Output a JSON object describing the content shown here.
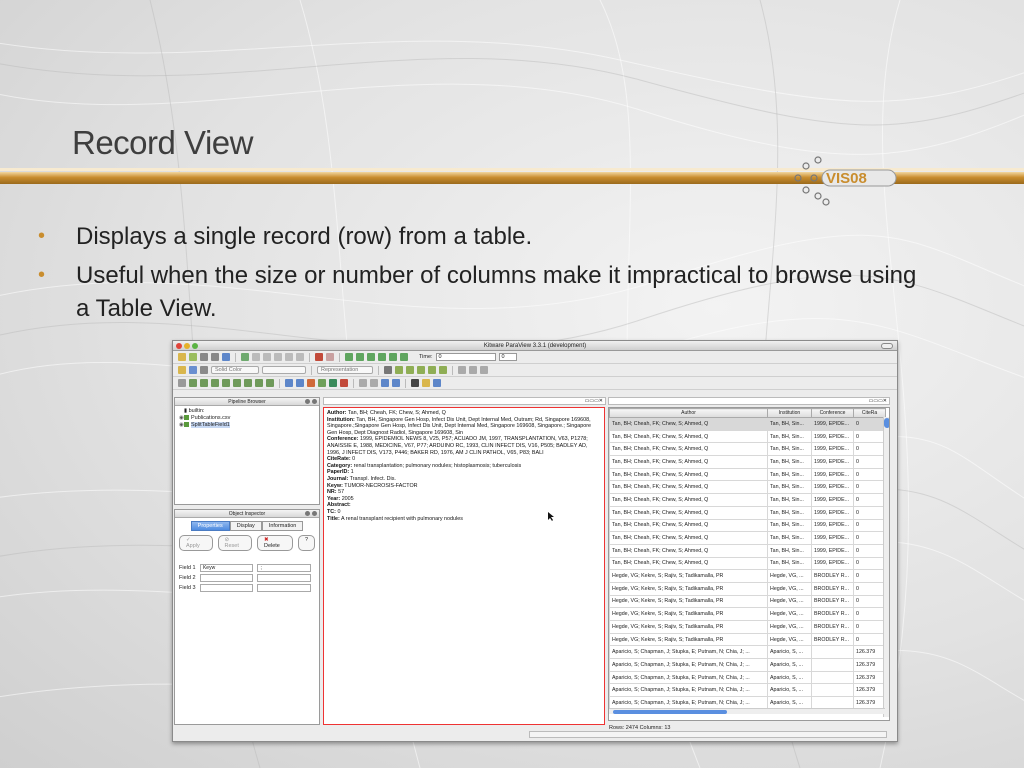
{
  "slide": {
    "title": "Record View",
    "bullets": [
      "Displays a single record (row) from a table.",
      "Useful when the size or number of columns make it impractical to browse using a Table View."
    ],
    "logo_text": "VIS08",
    "accent_color": "#c98d2e"
  },
  "app": {
    "window_title": "Kitware ParaView 3.3.1 (development)",
    "toolbar": {
      "time_label": "Time:",
      "time_value": "0",
      "time_index": "0",
      "solid_color_label": "Solid Color",
      "representation_label": "Representation"
    },
    "pipeline_browser": {
      "title": "Pipeline Browser",
      "items": [
        "builtin:",
        "Publications.csv",
        "SplitTableField1"
      ]
    },
    "object_inspector": {
      "title": "Object Inspector",
      "tabs": [
        "Properties",
        "Display",
        "Information"
      ],
      "buttons": {
        "apply": "Apply",
        "reset": "Reset",
        "delete": "Delete",
        "help": "?"
      },
      "fields": [
        {
          "label": "Field 1",
          "value1": "Keyw",
          "value2": ";"
        },
        {
          "label": "Field 2",
          "value1": "",
          "value2": ""
        },
        {
          "label": "Field 3",
          "value1": "",
          "value2": ""
        }
      ]
    },
    "record": [
      {
        "key": "Author:",
        "value": "Tan, BH; Cheah, FK; Chew, S; Ahmed, Q"
      },
      {
        "key": "Institution:",
        "value": "Tan, BH, Singapore Gen Hosp, Infect Dis Unit, Dept Internal Med, Outram; Rd, Singapore 169608, Singapore.;Singapore Gen Hosp, Infect Dis Unit, Dept Internal Med, Singapore 169608, Singapore.; Singapore Gen Hosp, Dept Diagnost Radiol, Singapore 169608, Sin"
      },
      {
        "key": "Conference:",
        "value": "1999, EPIDEMIOL NEWS 8, V25, P57; ACUADO JM, 1997, TRANSPLANTATION, V63, P1278; ANAISSIE E, 1988, MEDICINE, V67, P77; ARDUINO RC, 1993, CLIN INFECT DIS, V16, P505; BADLEY AD, 1996, J INFECT DIS, V173, P446; BAKER RD, 1976, AM J CLIN PATHOL, V65, P83; BALI"
      },
      {
        "key": "CiteRate:",
        "value": "0"
      },
      {
        "key": "Category:",
        "value": "renal transplantation; pulmonary nodules; histoplasmosis; tuberculosis"
      },
      {
        "key": "PaperID:",
        "value": "1"
      },
      {
        "key": "Journal:",
        "value": "Transpl. Infect. Dis."
      },
      {
        "key": "Keyw:",
        "value": "TUMOR-NECROSIS-FACTOR"
      },
      {
        "key": "NR:",
        "value": "57"
      },
      {
        "key": "Year:",
        "value": "2005"
      },
      {
        "key": "Abstract:",
        "value": ""
      },
      {
        "key": "TC:",
        "value": "0"
      },
      {
        "key": "Title:",
        "value": "A renal transplant recipient with pulmonary nodules"
      }
    ],
    "table": {
      "columns": [
        "Author",
        "Institution",
        "Conference",
        "CiteRa"
      ],
      "rows": [
        [
          "Tan, BH; Cheah, FK; Chew, S; Ahmed, Q",
          "Tan, BH, Sin...",
          "1999, EPIDE...",
          "0"
        ],
        [
          "Tan, BH; Cheah, FK; Chew, S; Ahmed, Q",
          "Tan, BH, Sin...",
          "1999, EPIDE...",
          "0"
        ],
        [
          "Tan, BH; Cheah, FK; Chew, S; Ahmed, Q",
          "Tan, BH, Sin...",
          "1999, EPIDE...",
          "0"
        ],
        [
          "Tan, BH; Cheah, FK; Chew, S; Ahmed, Q",
          "Tan, BH, Sin...",
          "1999, EPIDE...",
          "0"
        ],
        [
          "Tan, BH; Cheah, FK; Chew, S; Ahmed, Q",
          "Tan, BH, Sin...",
          "1999, EPIDE...",
          "0"
        ],
        [
          "Tan, BH; Cheah, FK; Chew, S; Ahmed, Q",
          "Tan, BH, Sin...",
          "1999, EPIDE...",
          "0"
        ],
        [
          "Tan, BH; Cheah, FK; Chew, S; Ahmed, Q",
          "Tan, BH, Sin...",
          "1999, EPIDE...",
          "0"
        ],
        [
          "Tan, BH; Cheah, FK; Chew, S; Ahmed, Q",
          "Tan, BH, Sin...",
          "1999, EPIDE...",
          "0"
        ],
        [
          "Tan, BH; Cheah, FK; Chew, S; Ahmed, Q",
          "Tan, BH, Sin...",
          "1999, EPIDE...",
          "0"
        ],
        [
          "Tan, BH; Cheah, FK; Chew, S; Ahmed, Q",
          "Tan, BH, Sin...",
          "1999, EPIDE...",
          "0"
        ],
        [
          "Tan, BH; Cheah, FK; Chew, S; Ahmed, Q",
          "Tan, BH, Sin...",
          "1999, EPIDE...",
          "0"
        ],
        [
          "Tan, BH; Cheah, FK; Chew, S; Ahmed, Q",
          "Tan, BH, Sin...",
          "1999, EPIDE...",
          "0"
        ],
        [
          "Hegde, VG; Kekre, S; Rajiv, S; Tadikamalla, PR",
          "Hegde, VG, ...",
          "BRODLEY R...",
          "0"
        ],
        [
          "Hegde, VG; Kekre, S; Rajiv, S; Tadikamalla, PR",
          "Hegde, VG, ...",
          "BRODLEY R...",
          "0"
        ],
        [
          "Hegde, VG; Kekre, S; Rajiv, S; Tadikamalla, PR",
          "Hegde, VG, ...",
          "BRODLEY R...",
          "0"
        ],
        [
          "Hegde, VG; Kekre, S; Rajiv, S; Tadikamalla, PR",
          "Hegde, VG, ...",
          "BRODLEY R...",
          "0"
        ],
        [
          "Hegde, VG; Kekre, S; Rajiv, S; Tadikamalla, PR",
          "Hegde, VG, ...",
          "BRODLEY R...",
          "0"
        ],
        [
          "Hegde, VG; Kekre, S; Rajiv, S; Tadikamalla, PR",
          "Hegde, VG, ...",
          "BRODLEY R...",
          "0"
        ],
        [
          "Aparicio, S; Chapman, J; Stupka, E; Putnam, N; Chia, J; ...",
          "Aparicio, S, ...",
          "",
          "126.379"
        ],
        [
          "Aparicio, S; Chapman, J; Stupka, E; Putnam, N; Chia, J; ...",
          "Aparicio, S, ...",
          "",
          "126.379"
        ],
        [
          "Aparicio, S; Chapman, J; Stupka, E; Putnam, N; Chia, J; ...",
          "Aparicio, S, ...",
          "",
          "126.379"
        ],
        [
          "Aparicio, S; Chapman, J; Stupka, E; Putnam, N; Chia, J; ...",
          "Aparicio, S, ...",
          "",
          "126.379"
        ],
        [
          "Aparicio, S; Chapman, J; Stupka, E; Putnam, N; Chia, J; ...",
          "Aparicio, S, ...",
          "",
          "126.379"
        ]
      ],
      "status": "Rows: 2474  Columns: 13"
    }
  }
}
